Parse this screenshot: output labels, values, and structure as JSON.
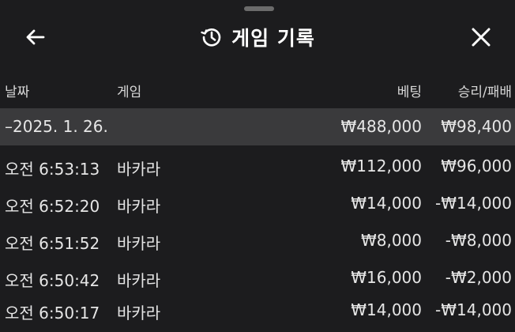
{
  "header": {
    "title": "게임 기록",
    "back_icon": "arrow-left-icon",
    "history_icon": "history-icon",
    "close_icon": "close-icon"
  },
  "columns": {
    "date": "날짜",
    "game": "게임",
    "bet": "베팅",
    "win_loss": "승리/패배"
  },
  "summary": {
    "date": "–2025. 1. 26.",
    "bet": "₩488,000",
    "win_loss": "₩98,400"
  },
  "rows": [
    {
      "time": "오전 6:53:13",
      "game": "바카라",
      "bet": "₩112,000",
      "win_loss": "₩96,000"
    },
    {
      "time": "오전 6:52:20",
      "game": "바카라",
      "bet": "₩14,000",
      "win_loss": "-₩14,000"
    },
    {
      "time": "오전 6:51:52",
      "game": "바카라",
      "bet": "₩8,000",
      "win_loss": "-₩8,000"
    },
    {
      "time": "오전 6:50:42",
      "game": "바카라",
      "bet": "₩16,000",
      "win_loss": "-₩2,000"
    },
    {
      "time": "오전 6:50:17",
      "game": "바카라",
      "bet": "₩14,000",
      "win_loss": "-₩14,000"
    }
  ],
  "colors": {
    "background": "#1c1c1e",
    "summary_row": "#3a3a3c",
    "text": "#e6e6e6"
  }
}
